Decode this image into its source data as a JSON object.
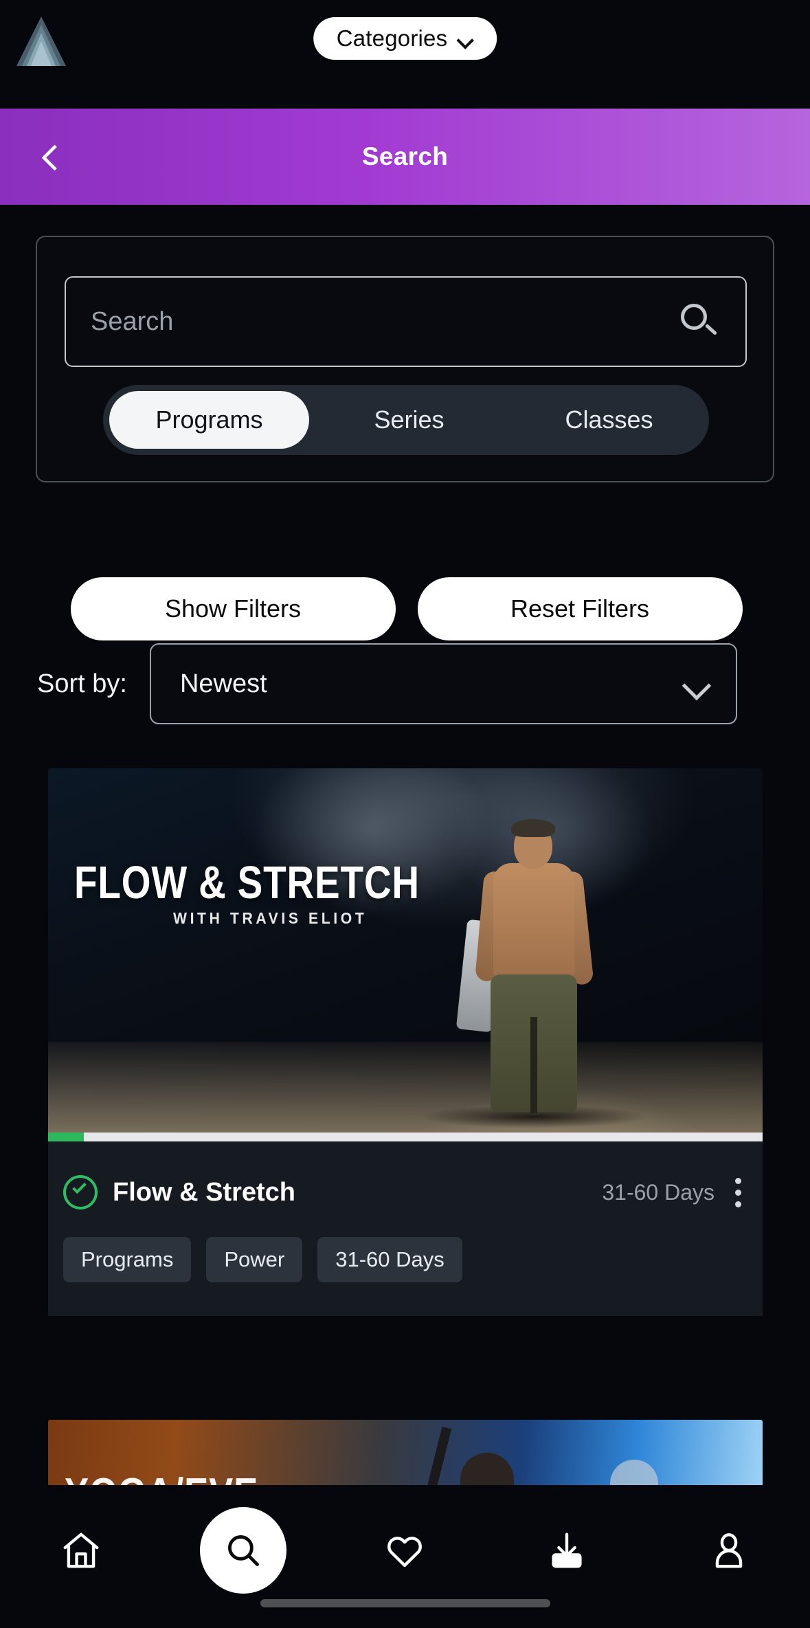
{
  "topbar": {
    "logo_name": "pyramid-logo",
    "categories_label": "Categories"
  },
  "header": {
    "title": "Search",
    "back_label": "Back"
  },
  "search": {
    "placeholder": "Search",
    "value": "",
    "icon": "search-icon"
  },
  "segmented": {
    "options": [
      {
        "label": "Programs",
        "active": true
      },
      {
        "label": "Series",
        "active": false
      },
      {
        "label": "Classes",
        "active": false
      }
    ]
  },
  "filters": {
    "show_label": "Show Filters",
    "reset_label": "Reset Filters"
  },
  "sort": {
    "label": "Sort by:",
    "value": "Newest",
    "icon": "chevron-down-icon"
  },
  "results": [
    {
      "artwork_title": "FLOW & STRETCH",
      "artwork_subtitle": "WITH TRAVIS ELIOT",
      "title": "Flow & Stretch",
      "meta": "31-60 Days",
      "progress_percent": 5,
      "progress_color": "#2eb85c",
      "completed_icon": "check-circle-icon",
      "menu_icon": "kebab-menu-icon",
      "tags": [
        "Programs",
        "Power",
        "31-60 Days"
      ]
    },
    {
      "artwork_title": "YOGA/EVE"
    }
  ],
  "bottom_nav": [
    {
      "name": "home-icon",
      "label": "Home",
      "active": false
    },
    {
      "name": "search-icon",
      "label": "Search",
      "active": true
    },
    {
      "name": "heart-icon",
      "label": "Favorites",
      "active": false
    },
    {
      "name": "download-icon",
      "label": "Downloads",
      "active": false
    },
    {
      "name": "profile-icon",
      "label": "Profile",
      "active": false
    }
  ],
  "colors": {
    "background": "#05070c",
    "header_gradient_start": "#8a2fbe",
    "header_gradient_end": "#b565dd",
    "accent_green": "#2fbd63",
    "card_panel": "#161b22",
    "tag_bg": "#2c333c"
  }
}
